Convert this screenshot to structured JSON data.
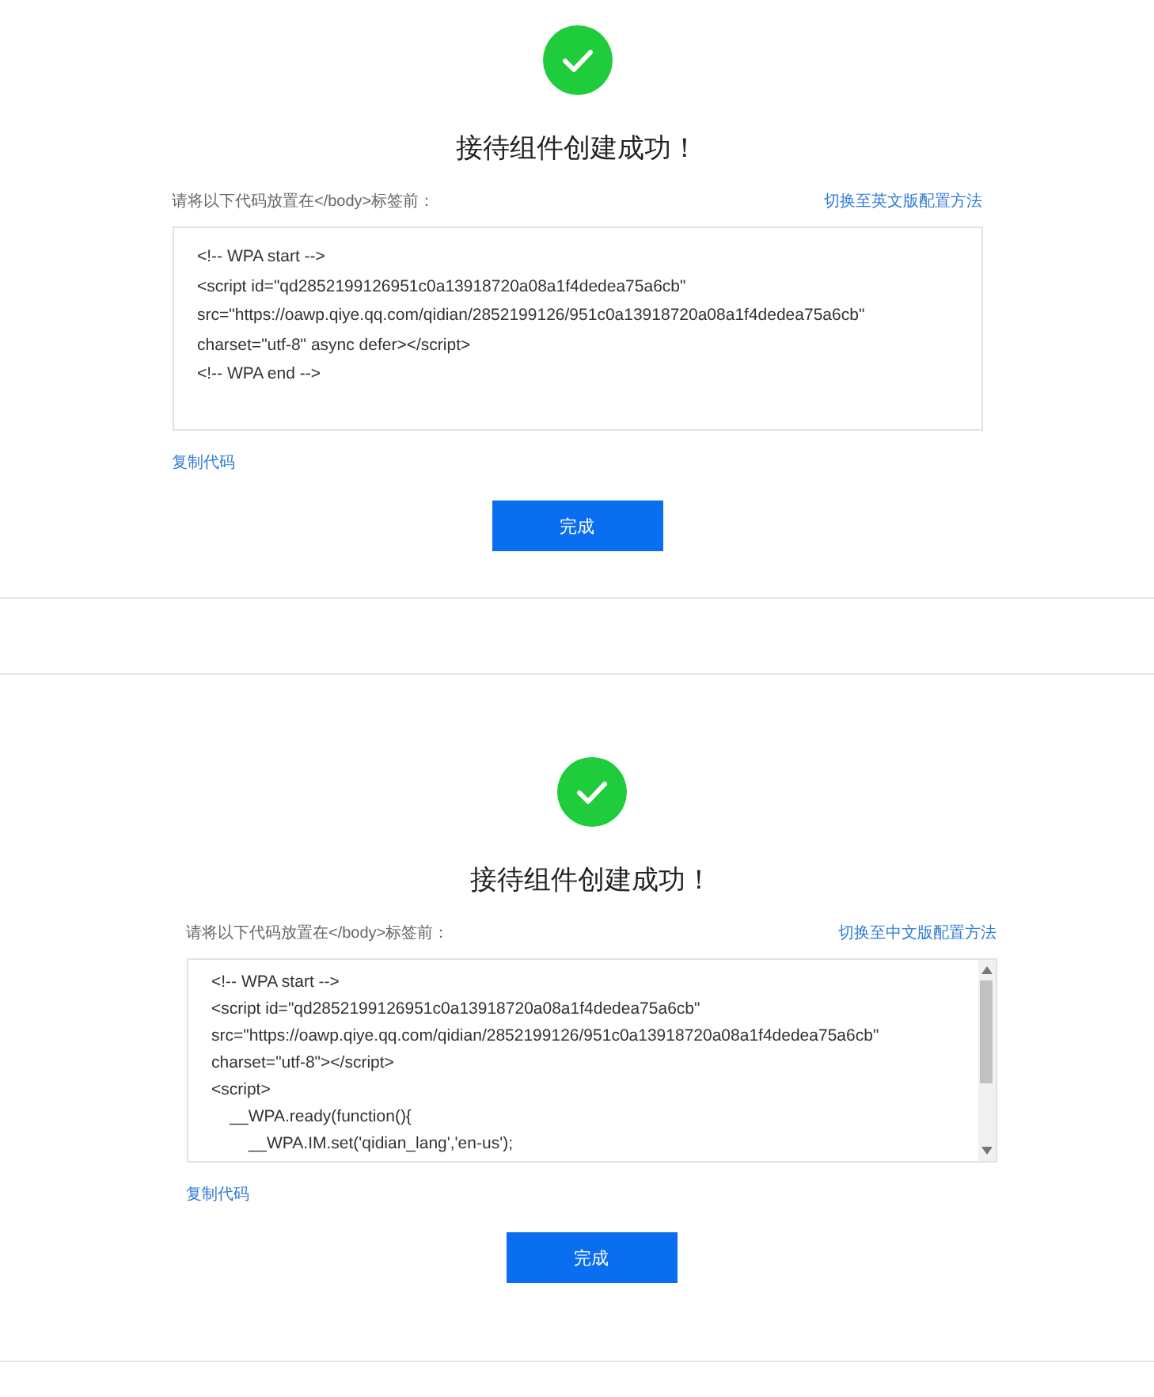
{
  "panels": [
    {
      "title": "接待组件创建成功！",
      "instruction": "请将以下代码放置在</body>标签前：",
      "switch_link": "切换至英文版配置方法",
      "scrollable": false,
      "code_lines": [
        "<!-- WPA start -->",
        "<script id=\"qd2852199126951c0a13918720a08a1f4dedea75a6cb\"",
        "src=\"https://oawp.qiye.qq.com/qidian/2852199126/951c0a13918720a08a1f4dedea75a6cb\"",
        "charset=\"utf-8\" async defer></script>",
        "<!-- WPA end -->"
      ],
      "copy_link": "复制代码",
      "done_button": "完成"
    },
    {
      "title": "接待组件创建成功！",
      "instruction": "请将以下代码放置在</body>标签前：",
      "switch_link": "切换至中文版配置方法",
      "scrollable": true,
      "code_lines": [
        "<!-- WPA start -->",
        "<script id=\"qd2852199126951c0a13918720a08a1f4dedea75a6cb\"",
        "src=\"https://oawp.qiye.qq.com/qidian/2852199126/951c0a13918720a08a1f4dedea75a6cb\"",
        "charset=\"utf-8\"></script>",
        "<script>",
        "    __WPA.ready(function(){",
        "        __WPA.IM.set('qidian_lang','en-us');"
      ],
      "copy_link": "复制代码",
      "done_button": "完成"
    }
  ]
}
